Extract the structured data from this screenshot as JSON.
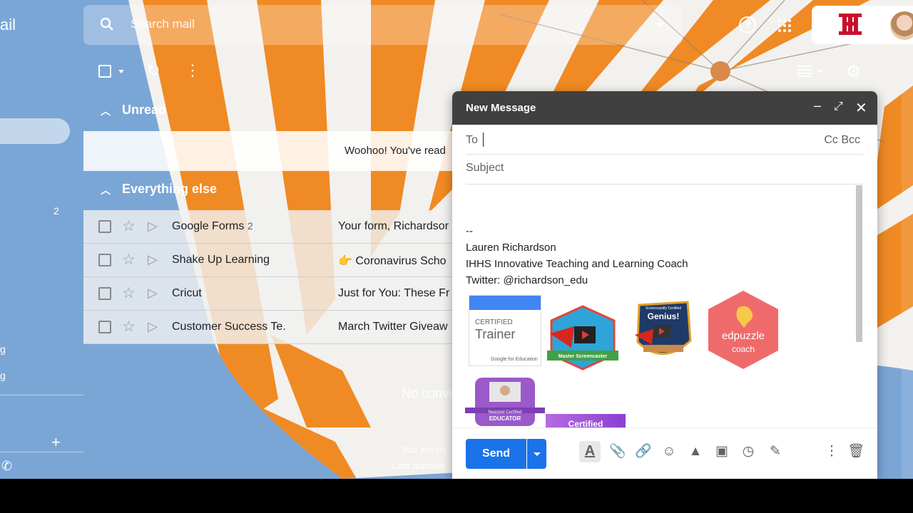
{
  "app": {
    "logo_fragment": "ail"
  },
  "search": {
    "placeholder": "Search mail"
  },
  "sidebar": {
    "count": "2",
    "fragment_1": "g",
    "fragment_2": "g"
  },
  "sections": {
    "unread": "Unread",
    "everything_else": "Everything else"
  },
  "unread_row": {
    "text": "Woohoo! You've read"
  },
  "emails": [
    {
      "sender": "Google Forms",
      "count": "2",
      "subject": "Your form, Richardsor"
    },
    {
      "sender": "Shake Up Learning",
      "count": "",
      "emoji": "👉",
      "subject": "Coronavirus Scho"
    },
    {
      "sender": "Cricut",
      "count": "",
      "subject": "Just for You: These Fr"
    },
    {
      "sender": "Customer Success Te.",
      "count": "",
      "subject": "March Twitter Giveaw"
    }
  ],
  "main": {
    "no_conversations": "No conve",
    "footer_line_1": "You are cu",
    "footer_line_2": "Last account"
  },
  "compose": {
    "title": "New Message",
    "to_label": "To",
    "cc_bcc": "Cc Bcc",
    "subject_placeholder": "Subject",
    "signature": {
      "sep": "--",
      "name": "Lauren Richardson",
      "role": "IHHS Innovative Teaching and Learning Coach",
      "twitter": "Twitter: @richardson_edu"
    },
    "badges": {
      "trainer_line1": "CERTIFIED",
      "trainer_line2": "Trainer",
      "trainer_line3": "Google for Education",
      "screencaster": "Master Screencaster",
      "genius_top": "Screencastify Certified",
      "genius": "Genius!",
      "edpuzzle": "edpuzzle",
      "edpuzzle_sub": "coach",
      "nearpod_top": "Nearpod Certified",
      "nearpod": "EDUCATOR",
      "certified": "Certified"
    },
    "send_label": "Send"
  },
  "colors": {
    "send_blue": "#1a73e8",
    "compose_header": "#404040",
    "stripe_orange": "#f08a24"
  }
}
